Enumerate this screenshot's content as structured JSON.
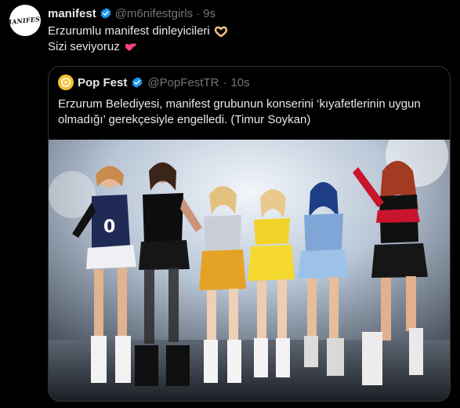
{
  "tweet": {
    "author_name": "manifest",
    "handle": "@m6nifestgirls",
    "separator": "·",
    "time": "9s",
    "line1": "Erzurumlu manifest dinleyicileri",
    "line2": "Sizi seviyoruz",
    "avatar_logo_text": "MANIFEST"
  },
  "quote": {
    "author_name": "Pop Fest",
    "handle": "@PopFestTR",
    "separator": "·",
    "time": "10s",
    "text": "Erzurum Belediyesi, manifest grubunun konserini ‘kıyafetlerinin uygun olmadığı’ gerekçesiyle engelledi. (Timur Soykan)"
  },
  "icons": {
    "verified": "verified-badge-icon",
    "heart_hands": "heart-hands-emoji-icon",
    "hearts": "two-hearts-emoji-icon",
    "popfest_logo": "popfest-logo-icon"
  },
  "colors": {
    "background": "#000000",
    "text": "#e7e9ea",
    "muted": "#71767b",
    "verified": "#1d9bf0",
    "border": "#2f3336"
  }
}
